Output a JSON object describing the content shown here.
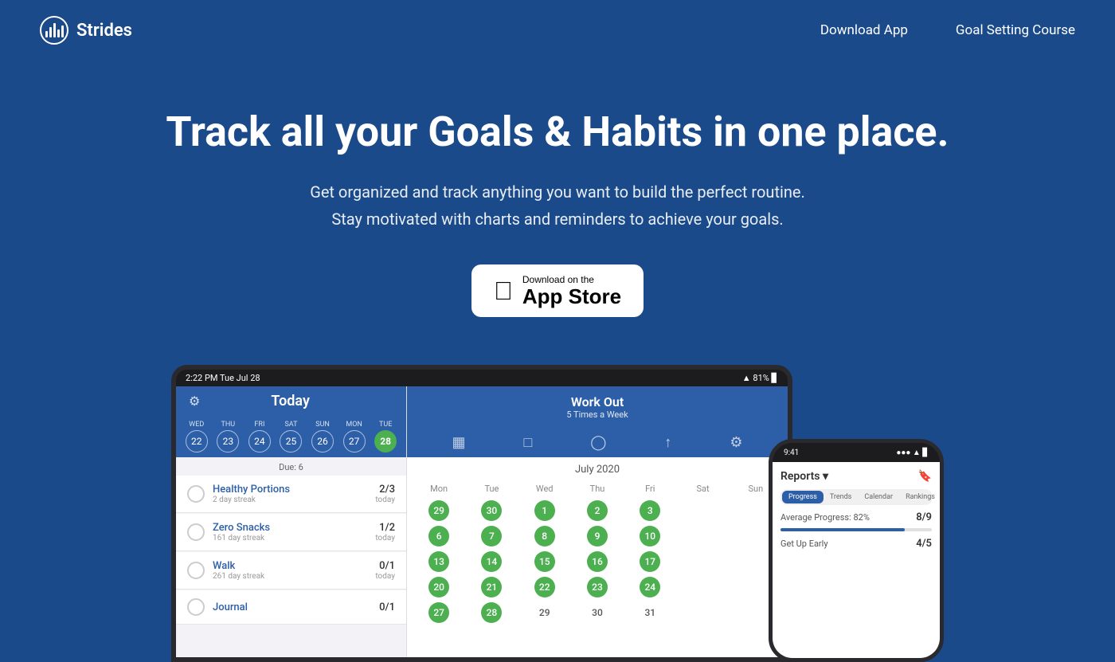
{
  "brand": {
    "name": "Strides",
    "logo_icon": "chart-bars"
  },
  "nav": {
    "download_app": "Download App",
    "goal_setting_course": "Goal Setting Course"
  },
  "hero": {
    "title": "Track all your Goals & Habits in one place.",
    "subtitle_line1": "Get organized and track anything you want to build the perfect routine.",
    "subtitle_line2": "Stay motivated with charts and reminders to achieve your goals.",
    "cta_small": "Download on the",
    "cta_large": "App Store"
  },
  "ipad": {
    "status_time": "2:22 PM  Tue Jul 28",
    "today_title": "Today",
    "day_strip": [
      {
        "label": "WED",
        "num": "22",
        "active": false
      },
      {
        "label": "THU",
        "num": "23",
        "active": false
      },
      {
        "label": "FRI",
        "num": "24",
        "active": false
      },
      {
        "label": "SAT",
        "num": "25",
        "active": false
      },
      {
        "label": "SUN",
        "num": "26",
        "active": false
      },
      {
        "label": "MON",
        "num": "27",
        "active": false
      },
      {
        "label": "TUE",
        "num": "28",
        "active": true
      }
    ],
    "due_label": "Due: 6",
    "habits": [
      {
        "name": "Healthy Portions",
        "streak": "2 day streak",
        "progress": "2/3",
        "sub": "today"
      },
      {
        "name": "Zero Snacks",
        "streak": "161 day streak",
        "progress": "1/2",
        "sub": "today"
      },
      {
        "name": "Walk",
        "streak": "261 day streak",
        "progress": "0/1",
        "sub": "today"
      },
      {
        "name": "Journal",
        "streak": "",
        "progress": "0/1",
        "sub": ""
      }
    ],
    "workout_name": "Work Out",
    "workout_sub": "5 Times a Week",
    "calendar_month": "July 2020",
    "cal_headers": [
      "Mon",
      "Tue",
      "Wed",
      "Thu",
      "Fri",
      "Sat",
      "Sun"
    ],
    "cal_rows": [
      [
        {
          "val": "29",
          "green": true
        },
        {
          "val": "30",
          "green": true
        },
        {
          "val": "1",
          "green": true
        },
        {
          "val": "2",
          "green": true
        },
        {
          "val": "3",
          "green": true
        },
        {
          "val": "",
          "green": false
        },
        {
          "val": "",
          "green": false
        }
      ],
      [
        {
          "val": "6",
          "green": true
        },
        {
          "val": "7",
          "green": true
        },
        {
          "val": "8",
          "green": true
        },
        {
          "val": "9",
          "green": true
        },
        {
          "val": "10",
          "green": true
        },
        {
          "val": "",
          "green": false
        },
        {
          "val": "",
          "green": false
        }
      ],
      [
        {
          "val": "13",
          "green": true
        },
        {
          "val": "14",
          "green": true
        },
        {
          "val": "15",
          "green": true
        },
        {
          "val": "16",
          "green": true
        },
        {
          "val": "17",
          "green": true
        },
        {
          "val": "",
          "green": false
        },
        {
          "val": "",
          "green": false
        }
      ],
      [
        {
          "val": "20",
          "green": true
        },
        {
          "val": "21",
          "green": true
        },
        {
          "val": "22",
          "green": true
        },
        {
          "val": "23",
          "green": true
        },
        {
          "val": "24",
          "green": true
        },
        {
          "val": "",
          "green": false
        },
        {
          "val": "",
          "green": false
        }
      ],
      [
        {
          "val": "27",
          "green": true
        },
        {
          "val": "28",
          "green": true
        },
        {
          "val": "29",
          "green": false
        },
        {
          "val": "30",
          "green": false
        },
        {
          "val": "31",
          "green": false
        },
        {
          "val": "",
          "green": false
        },
        {
          "val": "",
          "green": false
        }
      ]
    ]
  },
  "iphone": {
    "status_time": "9:41",
    "status_icons": "●●● ▲ ▊",
    "reports_title": "Reports ▾",
    "tabs": [
      "Progress",
      "Trends",
      "Calendar",
      "Rankings"
    ],
    "avg_progress_label": "Average Progress: 82%",
    "avg_progress_value": "8/9",
    "progress_pct": 82,
    "get_up_label": "Get Up Early",
    "get_up_value": "4/5"
  }
}
